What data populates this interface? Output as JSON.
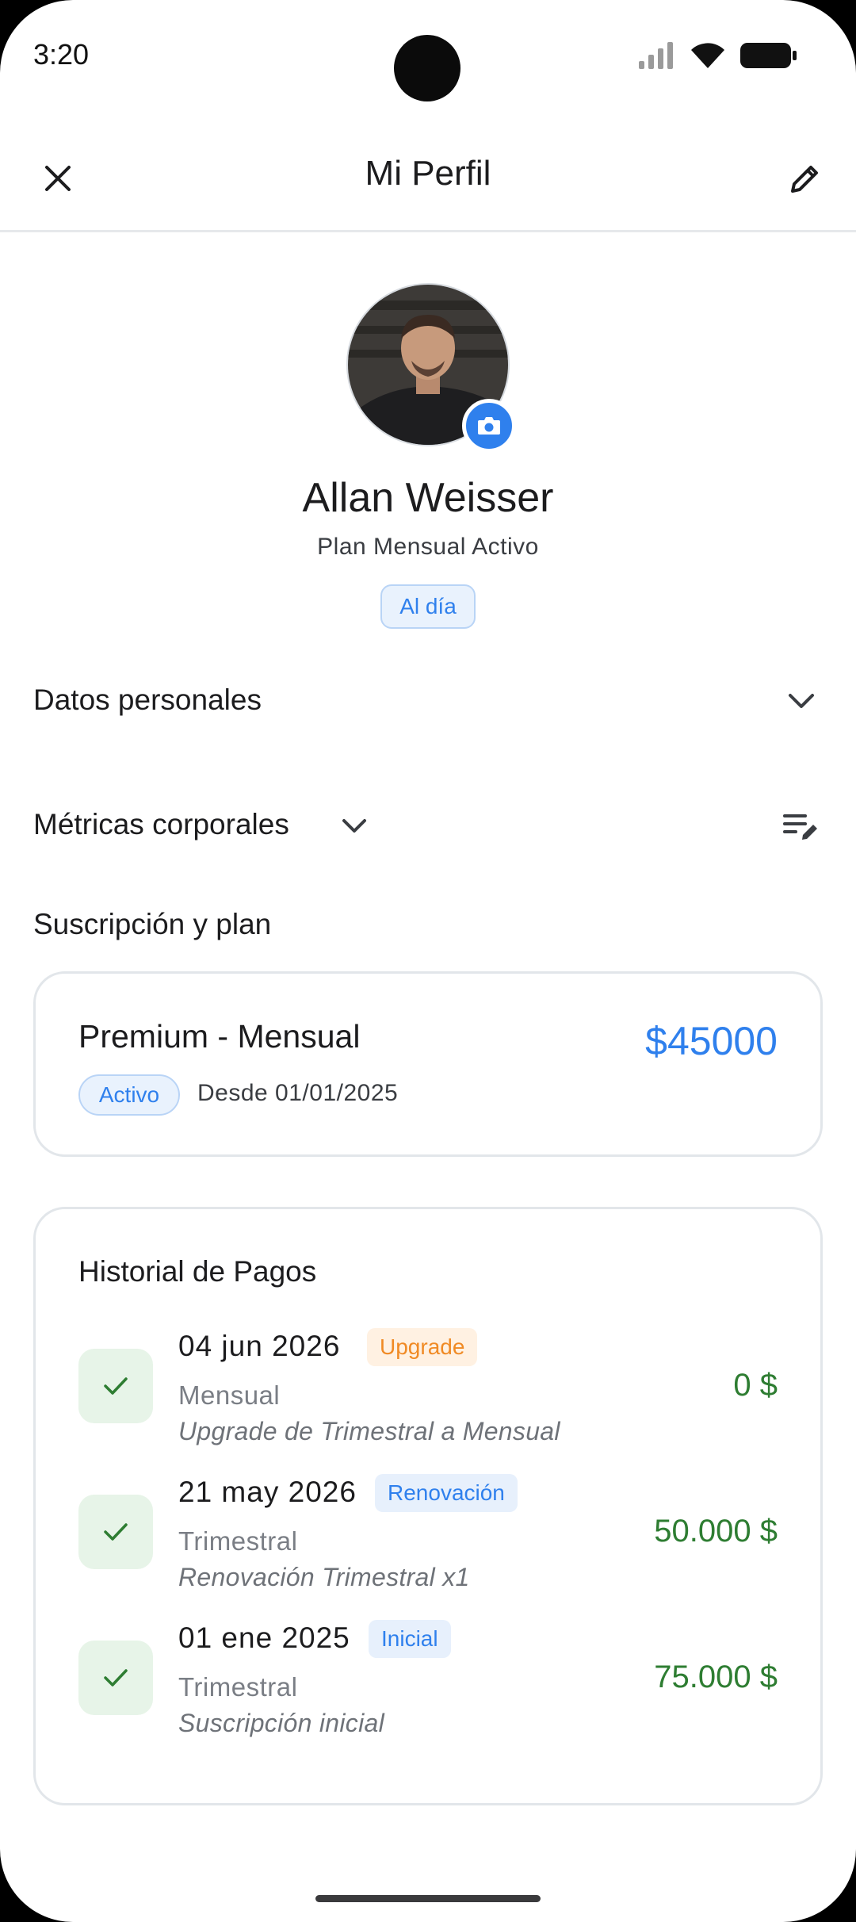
{
  "status_bar": {
    "time": "3:20"
  },
  "appbar": {
    "title": "Mi Perfil"
  },
  "profile": {
    "name": "Allan Weisser",
    "plan_subtitle": "Plan Mensual Activo",
    "status_chip": "Al día"
  },
  "sections": {
    "personal": "Datos personales",
    "metrics": "Métricas corporales",
    "subscription": "Suscripción y plan"
  },
  "subscription": {
    "plan_name": "Premium - Mensual",
    "price": "$45000",
    "status": "Activo",
    "since": "Desde 01/01/2025"
  },
  "payments": {
    "title": "Historial de Pagos",
    "items": [
      {
        "date": "04 jun 2026",
        "tag": "Upgrade",
        "tag_color": "#f08a24",
        "plan": "Mensual",
        "note": "Upgrade de Trimestral a Mensual",
        "amount": "0 $"
      },
      {
        "date": "21 may 2026",
        "tag": "Renovación",
        "tag_color": "#2f80ed",
        "plan": "Trimestral",
        "note": "Renovación Trimestral x1",
        "amount": "50.000 $"
      },
      {
        "date": "01 ene 2025",
        "tag": "Inicial",
        "tag_color": "#2f80ed",
        "plan": "Trimestral",
        "note": "Suscripción inicial",
        "amount": "75.000 $"
      }
    ]
  },
  "colors": {
    "accent": "#2f80ed",
    "success": "#2e7d32",
    "warning": "#f08a24"
  }
}
